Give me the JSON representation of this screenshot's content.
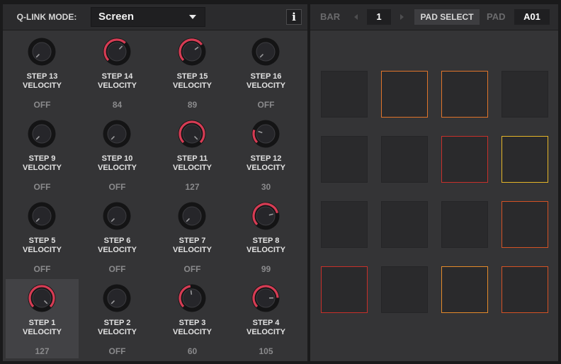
{
  "qlink": {
    "mode_label": "Q-LINK MODE:",
    "mode_value": "Screen",
    "info_label": "i"
  },
  "knobs": [
    {
      "step": "STEP 13",
      "param": "VELOCITY",
      "value": "OFF",
      "level": 0,
      "active": false
    },
    {
      "step": "STEP 14",
      "param": "VELOCITY",
      "value": "84",
      "level": 84,
      "active": true
    },
    {
      "step": "STEP 15",
      "param": "VELOCITY",
      "value": "89",
      "level": 89,
      "active": true
    },
    {
      "step": "STEP 16",
      "param": "VELOCITY",
      "value": "OFF",
      "level": 0,
      "active": false
    },
    {
      "step": "STEP 9",
      "param": "VELOCITY",
      "value": "OFF",
      "level": 0,
      "active": false
    },
    {
      "step": "STEP 10",
      "param": "VELOCITY",
      "value": "OFF",
      "level": 0,
      "active": false
    },
    {
      "step": "STEP 11",
      "param": "VELOCITY",
      "value": "127",
      "level": 127,
      "active": true
    },
    {
      "step": "STEP 12",
      "param": "VELOCITY",
      "value": "30",
      "level": 30,
      "active": true
    },
    {
      "step": "STEP 5",
      "param": "VELOCITY",
      "value": "OFF",
      "level": 0,
      "active": false
    },
    {
      "step": "STEP 6",
      "param": "VELOCITY",
      "value": "OFF",
      "level": 0,
      "active": false
    },
    {
      "step": "STEP 7",
      "param": "VELOCITY",
      "value": "OFF",
      "level": 0,
      "active": false
    },
    {
      "step": "STEP 8",
      "param": "VELOCITY",
      "value": "99",
      "level": 99,
      "active": true
    },
    {
      "step": "STEP 1",
      "param": "VELOCITY",
      "value": "127",
      "level": 127,
      "active": true,
      "selected": true
    },
    {
      "step": "STEP 2",
      "param": "VELOCITY",
      "value": "OFF",
      "level": 0,
      "active": false
    },
    {
      "step": "STEP 3",
      "param": "VELOCITY",
      "value": "60",
      "level": 60,
      "active": true
    },
    {
      "step": "STEP 4",
      "param": "VELOCITY",
      "value": "105",
      "level": 105,
      "active": true
    }
  ],
  "knob_max": 127,
  "colors": {
    "arc": "#d63c54",
    "pad_red": "#c8302a",
    "pad_orange_red": "#d45224",
    "pad_orange": "#e0742a",
    "pad_amber": "#e48a2a",
    "pad_yellow": "#e6b628"
  },
  "pad_panel": {
    "bar_label": "BAR",
    "bar_value": "1",
    "pad_select_label": "PAD SELECT",
    "pad_label": "PAD",
    "pad_value": "A01"
  },
  "pads": [
    [
      "",
      "pad_orange",
      "pad_orange",
      ""
    ],
    [
      "",
      "",
      "pad_red",
      "pad_yellow"
    ],
    [
      "",
      "",
      "",
      "pad_orange_red"
    ],
    [
      "pad_red",
      "",
      "pad_amber",
      "pad_orange_red"
    ]
  ]
}
